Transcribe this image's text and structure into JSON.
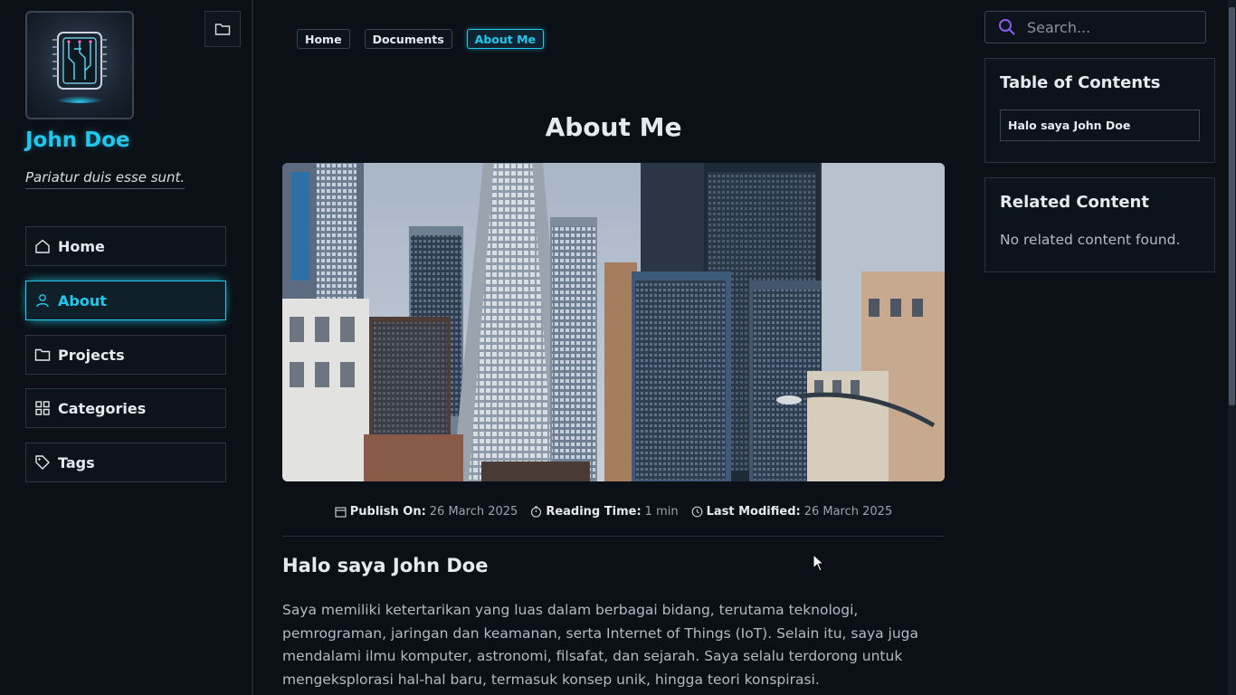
{
  "sidebar": {
    "site_title": "John Doe",
    "tagline": "Pariatur duis esse sunt.",
    "avatar_icon": "circuit-chip-icon",
    "folder_icon": "folder-icon",
    "nav": [
      {
        "label": "Home",
        "icon": "home-icon",
        "active": false
      },
      {
        "label": "About",
        "icon": "user-icon",
        "active": true
      },
      {
        "label": "Projects",
        "icon": "folder-icon",
        "active": false
      },
      {
        "label": "Categories",
        "icon": "grid-icon",
        "active": false
      },
      {
        "label": "Tags",
        "icon": "tag-icon",
        "active": false
      }
    ]
  },
  "breadcrumb": [
    {
      "label": "Home",
      "active": false
    },
    {
      "label": "Documents",
      "active": false
    },
    {
      "label": "About Me",
      "active": true
    }
  ],
  "page": {
    "title": "About Me",
    "hero_image": "city-skyline",
    "meta": {
      "publish_label": "Publish On:",
      "publish_value": "26 March 2025",
      "reading_label": "Reading Time:",
      "reading_value": "1 min",
      "modified_label": "Last Modified:",
      "modified_value": "26 March 2025"
    },
    "heading": "Halo saya John Doe",
    "paragraph": "Saya memiliki ketertarikan yang luas dalam berbagai bidang, terutama teknologi, pemrograman, jaringan dan keamanan, serta Internet of Things (IoT). Selain itu, saya juga mendalami ilmu komputer, astronomi, filsafat, dan sejarah. Saya selalu terdorong untuk mengeksplorasi hal-hal baru, termasuk konsep unik, hingga teori konspirasi."
  },
  "search": {
    "placeholder": "Search..."
  },
  "toc": {
    "title": "Table of Contents",
    "items": [
      "Halo saya  John Doe"
    ]
  },
  "related": {
    "title": "Related Content",
    "empty_text": "No related content found."
  },
  "colors": {
    "accent": "#22c8ec",
    "background": "#0b1017",
    "search_icon": "#8b5cf6"
  }
}
